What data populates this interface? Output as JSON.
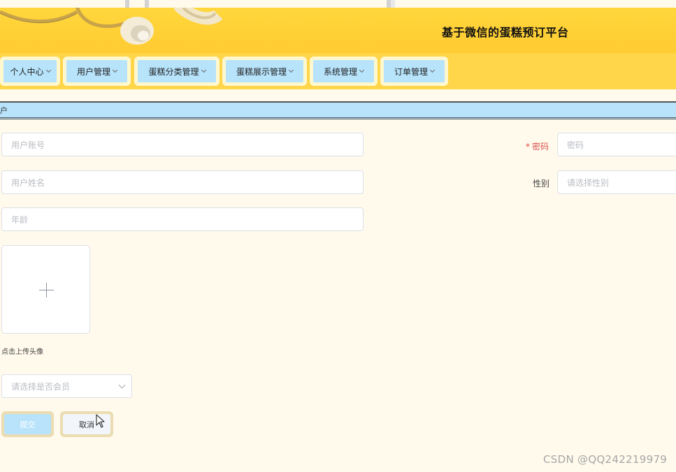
{
  "header": {
    "title": "基于微信的蛋糕预订平台"
  },
  "nav": {
    "items": [
      {
        "label": "个人中心"
      },
      {
        "label": "用户管理"
      },
      {
        "label": "蛋糕分类管理"
      },
      {
        "label": "蛋糕展示管理"
      },
      {
        "label": "系统管理"
      },
      {
        "label": "订单管理"
      }
    ]
  },
  "breadcrumb": {
    "text": "户"
  },
  "form": {
    "account_placeholder": "用户账号",
    "password_label": "密码",
    "password_required_mark": "*",
    "password_placeholder": "密码",
    "name_placeholder": "用户姓名",
    "gender_label": "性别",
    "gender_placeholder": "请选择性别",
    "age_placeholder": "年龄",
    "avatar_tip": "点击上传头像",
    "member_placeholder": "请选择是否会员",
    "submit_label": "提交",
    "cancel_label": "取消"
  },
  "watermark": {
    "text": "CSDN @QQ242219979"
  },
  "colors": {
    "header_yellow": "#ffd03a",
    "nav_blue": "#b7e3fb",
    "page_bg": "#fffaec"
  }
}
